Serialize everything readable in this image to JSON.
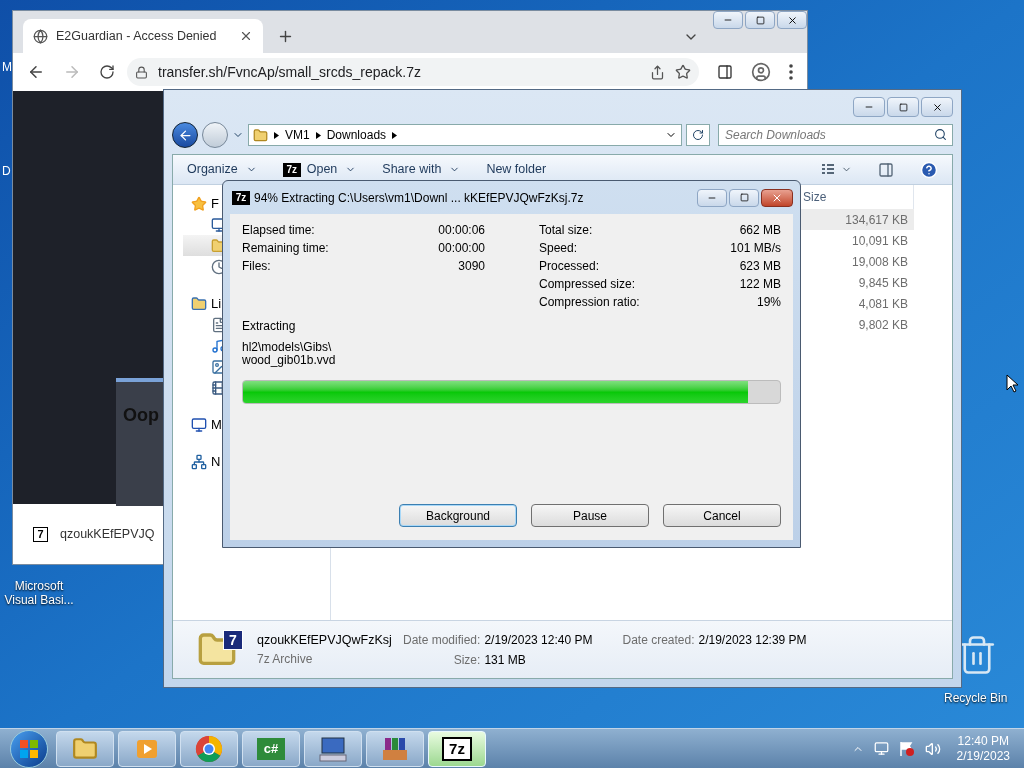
{
  "desktop": {
    "icons": [
      {
        "label": "M"
      },
      {
        "label": "D"
      },
      {
        "label": "Microsoft Visual Basi..."
      },
      {
        "label": "Recycle Bin"
      }
    ]
  },
  "browser": {
    "tab_title": "E2Guardian - Access Denied",
    "forward_disabled": true,
    "url": "transfer.sh/FvncAp/small_srcds_repack.7z",
    "page_heading": "Oop",
    "download": {
      "icon_text": "7",
      "name": "qzoukKEfEPVJQ"
    }
  },
  "explorer": {
    "breadcrumb": [
      "VM1",
      "Downloads"
    ],
    "search_placeholder": "Search Downloads",
    "toolbar": [
      {
        "label": "Organize",
        "dropdown": true
      },
      {
        "label": "Open",
        "dropdown": true,
        "icon_text": "7z"
      },
      {
        "label": "Share with",
        "dropdown": true
      },
      {
        "label": "New folder",
        "dropdown": false
      }
    ],
    "nav": [
      {
        "kind": "favorites",
        "label": "F",
        "selected": false,
        "children": [
          {
            "kind": "desktop",
            "selected": false
          },
          {
            "kind": "downloads",
            "selected": true
          },
          {
            "kind": "recent",
            "selected": false
          }
        ]
      },
      {
        "kind": "libraries",
        "label": "Li",
        "selected": false,
        "children": [
          {
            "kind": "documents",
            "selected": false
          },
          {
            "kind": "music",
            "selected": false
          },
          {
            "kind": "pictures",
            "selected": false
          },
          {
            "kind": "videos",
            "selected": false
          }
        ]
      },
      {
        "kind": "computer",
        "label": "M",
        "selected": false
      },
      {
        "kind": "network",
        "label": "N",
        "selected": false
      }
    ],
    "size_column": "Size",
    "rows": [
      {
        "size": "134,617 KB",
        "selected": true
      },
      {
        "size": "10,091 KB",
        "selected": false
      },
      {
        "size": "19,008 KB",
        "selected": false
      },
      {
        "size": "9,845 KB",
        "selected": false
      },
      {
        "size": "4,081 KB",
        "selected": false
      },
      {
        "size": "9,802 KB",
        "selected": false
      }
    ],
    "details": {
      "icon_text": "7",
      "name": "qzoukKEfEPVJQwFzKsj",
      "type": "7z Archive",
      "fields": [
        {
          "label": "Date modified:",
          "value": "2/19/2023 12:40 PM"
        },
        {
          "label": "Size:",
          "value": "131 MB"
        },
        {
          "label": "Date created:",
          "value": "2/19/2023 12:39 PM"
        }
      ]
    }
  },
  "dialog": {
    "icon_text": "7z",
    "title": "94% Extracting C:\\Users\\vm1\\Downl ... kKEfEPVJQwFzKsj.7z",
    "left": [
      {
        "label": "Elapsed time:",
        "value": "00:00:06"
      },
      {
        "label": "Remaining time:",
        "value": "00:00:00"
      },
      {
        "label": "Files:",
        "value": "3090"
      }
    ],
    "right": [
      {
        "label": "Total size:",
        "value": "662 MB"
      },
      {
        "label": "Speed:",
        "value": "101 MB/s"
      },
      {
        "label": "Processed:",
        "value": "623 MB"
      },
      {
        "label": "Compressed size:",
        "value": "122 MB"
      },
      {
        "label": "Compression ratio:",
        "value": "19%"
      }
    ],
    "status": "Extracting",
    "path": [
      "hl2\\models\\Gibs\\",
      "wood_gib01b.vvd"
    ],
    "progress": {
      "level": 0.94
    },
    "buttons": [
      {
        "label": "Background",
        "focused": true
      },
      {
        "label": "Pause",
        "focused": false
      },
      {
        "label": "Cancel",
        "focused": false
      }
    ]
  },
  "taskbar": {
    "items": [
      {
        "kind": "explorer",
        "active": false
      },
      {
        "kind": "media",
        "active": false
      },
      {
        "kind": "chrome",
        "active": false
      },
      {
        "kind": "csharp",
        "icon_text": "c#",
        "active": false
      },
      {
        "kind": "keyboard",
        "active": false
      },
      {
        "kind": "winrar",
        "active": false
      },
      {
        "kind": "sevenzip",
        "icon_text": "7z",
        "active": true
      }
    ],
    "time": "12:40 PM",
    "date": "2/19/2023"
  }
}
